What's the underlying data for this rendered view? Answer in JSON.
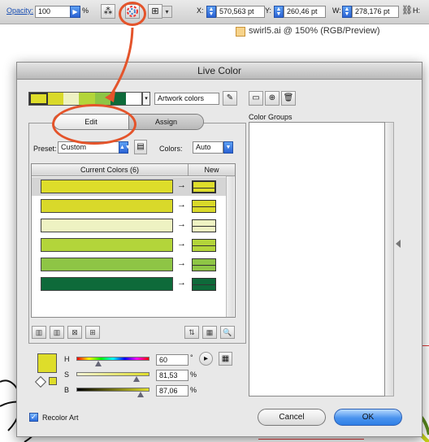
{
  "control_bar": {
    "opacity_label": "Opacity:",
    "opacity_value": "100",
    "percent": "%",
    "x_label": "X:",
    "x_value": "570,563 pt",
    "y_label": "Y:",
    "y_value": "260,46 pt",
    "w_label": "W:",
    "w_value": "278,176 pt"
  },
  "document": {
    "title": "swirl5.ai @ 150% (RGB/Preview)"
  },
  "dialog": {
    "title": "Live Color",
    "harmony_name": "Artwork colors",
    "tabs": [
      {
        "label": "Edit"
      },
      {
        "label": "Assign"
      }
    ],
    "preset_label": "Preset:",
    "preset_value": "Custom",
    "colors_label": "Colors:",
    "colors_value": "Auto",
    "table": {
      "col_current": "Current Colors (6)",
      "col_new": "New",
      "rows": [
        {
          "color": "#dedd2a",
          "selected": true
        },
        {
          "color": "#d9d92a",
          "selected": false
        },
        {
          "color": "#eef2c2",
          "selected": false
        },
        {
          "color": "#b3d53a",
          "selected": false
        },
        {
          "color": "#8ec545",
          "selected": false
        },
        {
          "color": "#0e6a3a",
          "selected": false
        }
      ]
    },
    "sliders": {
      "h_label": "H",
      "h_value": "60",
      "h_unit": "°",
      "s_label": "S",
      "s_value": "81,53",
      "s_unit": "%",
      "b_label": "B",
      "b_value": "87,06",
      "b_unit": "%"
    },
    "color_groups_label": "Color Groups",
    "recolor_art_label": "Recolor Art",
    "recolor_art_checked": true,
    "cancel_label": "Cancel",
    "ok_label": "OK"
  }
}
